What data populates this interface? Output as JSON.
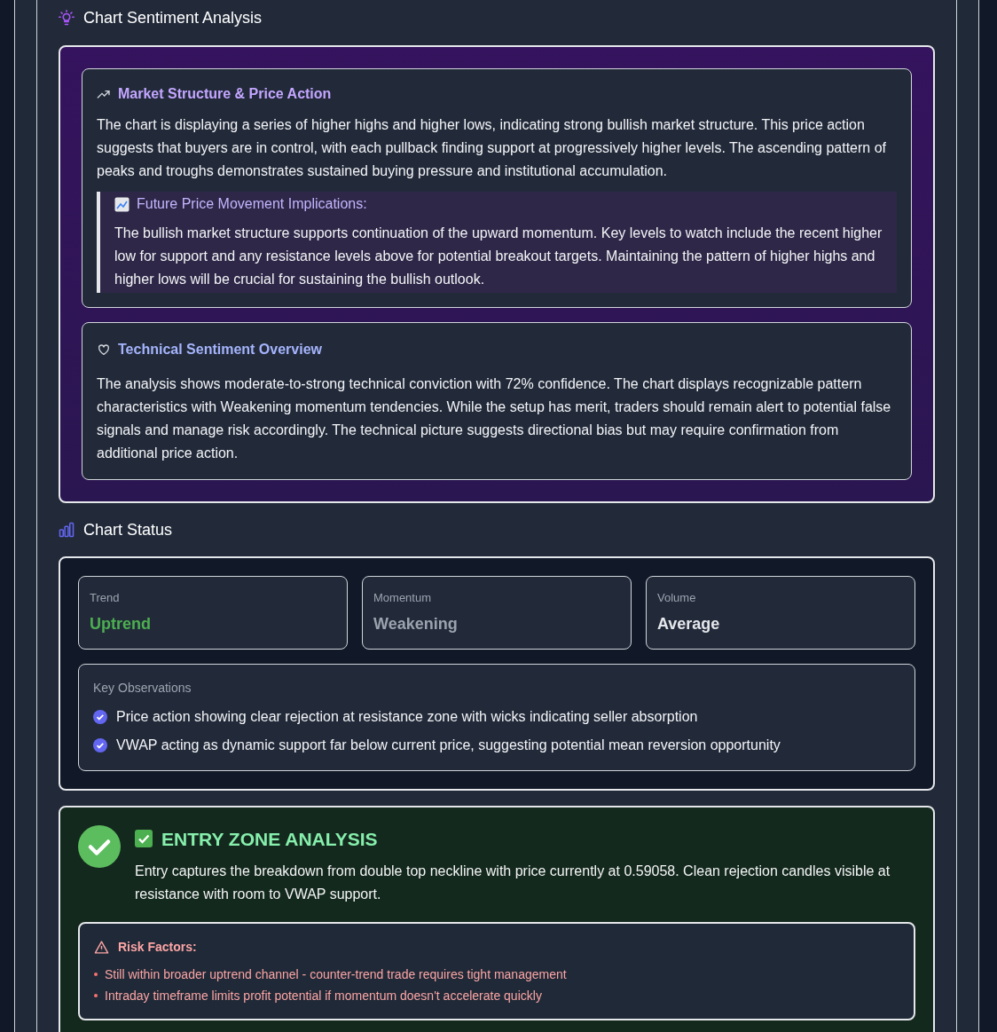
{
  "sentiment": {
    "title": "Chart Sentiment Analysis",
    "market_structure": {
      "title": "Market Structure & Price Action",
      "text": "The chart is displaying a series of higher highs and higher lows, indicating strong bullish market structure. This price action suggests that buyers are in control, with each pullback finding support at progressively higher levels. The ascending pattern of peaks and troughs demonstrates sustained buying pressure and institutional accumulation.",
      "implications": {
        "title": "Future Price Movement Implications:",
        "text": "The bullish market structure supports continuation of the upward momentum. Key levels to watch include the recent higher low for support and any resistance levels above for potential breakout targets. Maintaining the pattern of higher highs and higher lows will be crucial for sustaining the bullish outlook."
      }
    },
    "overview": {
      "title": "Technical Sentiment Overview",
      "text": "The analysis shows moderate-to-strong technical conviction with 72% confidence. The chart displays recognizable pattern characteristics with Weakening momentum tendencies. While the setup has merit, traders should remain alert to potential false signals and manage risk accordingly. The technical picture suggests directional bias but may require confirmation from additional price action."
    }
  },
  "chart_status": {
    "title": "Chart Status",
    "metrics": [
      {
        "label": "Trend",
        "value": "Uptrend",
        "color": "#4caf50"
      },
      {
        "label": "Momentum",
        "value": "Weakening",
        "color": "#9ca3af"
      },
      {
        "label": "Volume",
        "value": "Average",
        "color": "#e5e7eb"
      }
    ],
    "observations_title": "Key Observations",
    "observations": [
      "Price action showing clear rejection at resistance zone with wicks indicating seller absorption",
      "VWAP acting as dynamic support far below current price, suggesting potential mean reversion opportunity"
    ]
  },
  "entry_zone": {
    "title": "ENTRY ZONE ANALYSIS",
    "text": "Entry captures the breakdown from double top neckline with price currently at 0.59058. Clean rejection candles visible at resistance with room to VWAP support.",
    "risk_title": "Risk Factors:",
    "risks": [
      "Still within broader uptrend channel - counter-trend trade requires tight management",
      "Intraday timeframe limits profit potential if momentum doesn't accelerate quickly"
    ]
  }
}
